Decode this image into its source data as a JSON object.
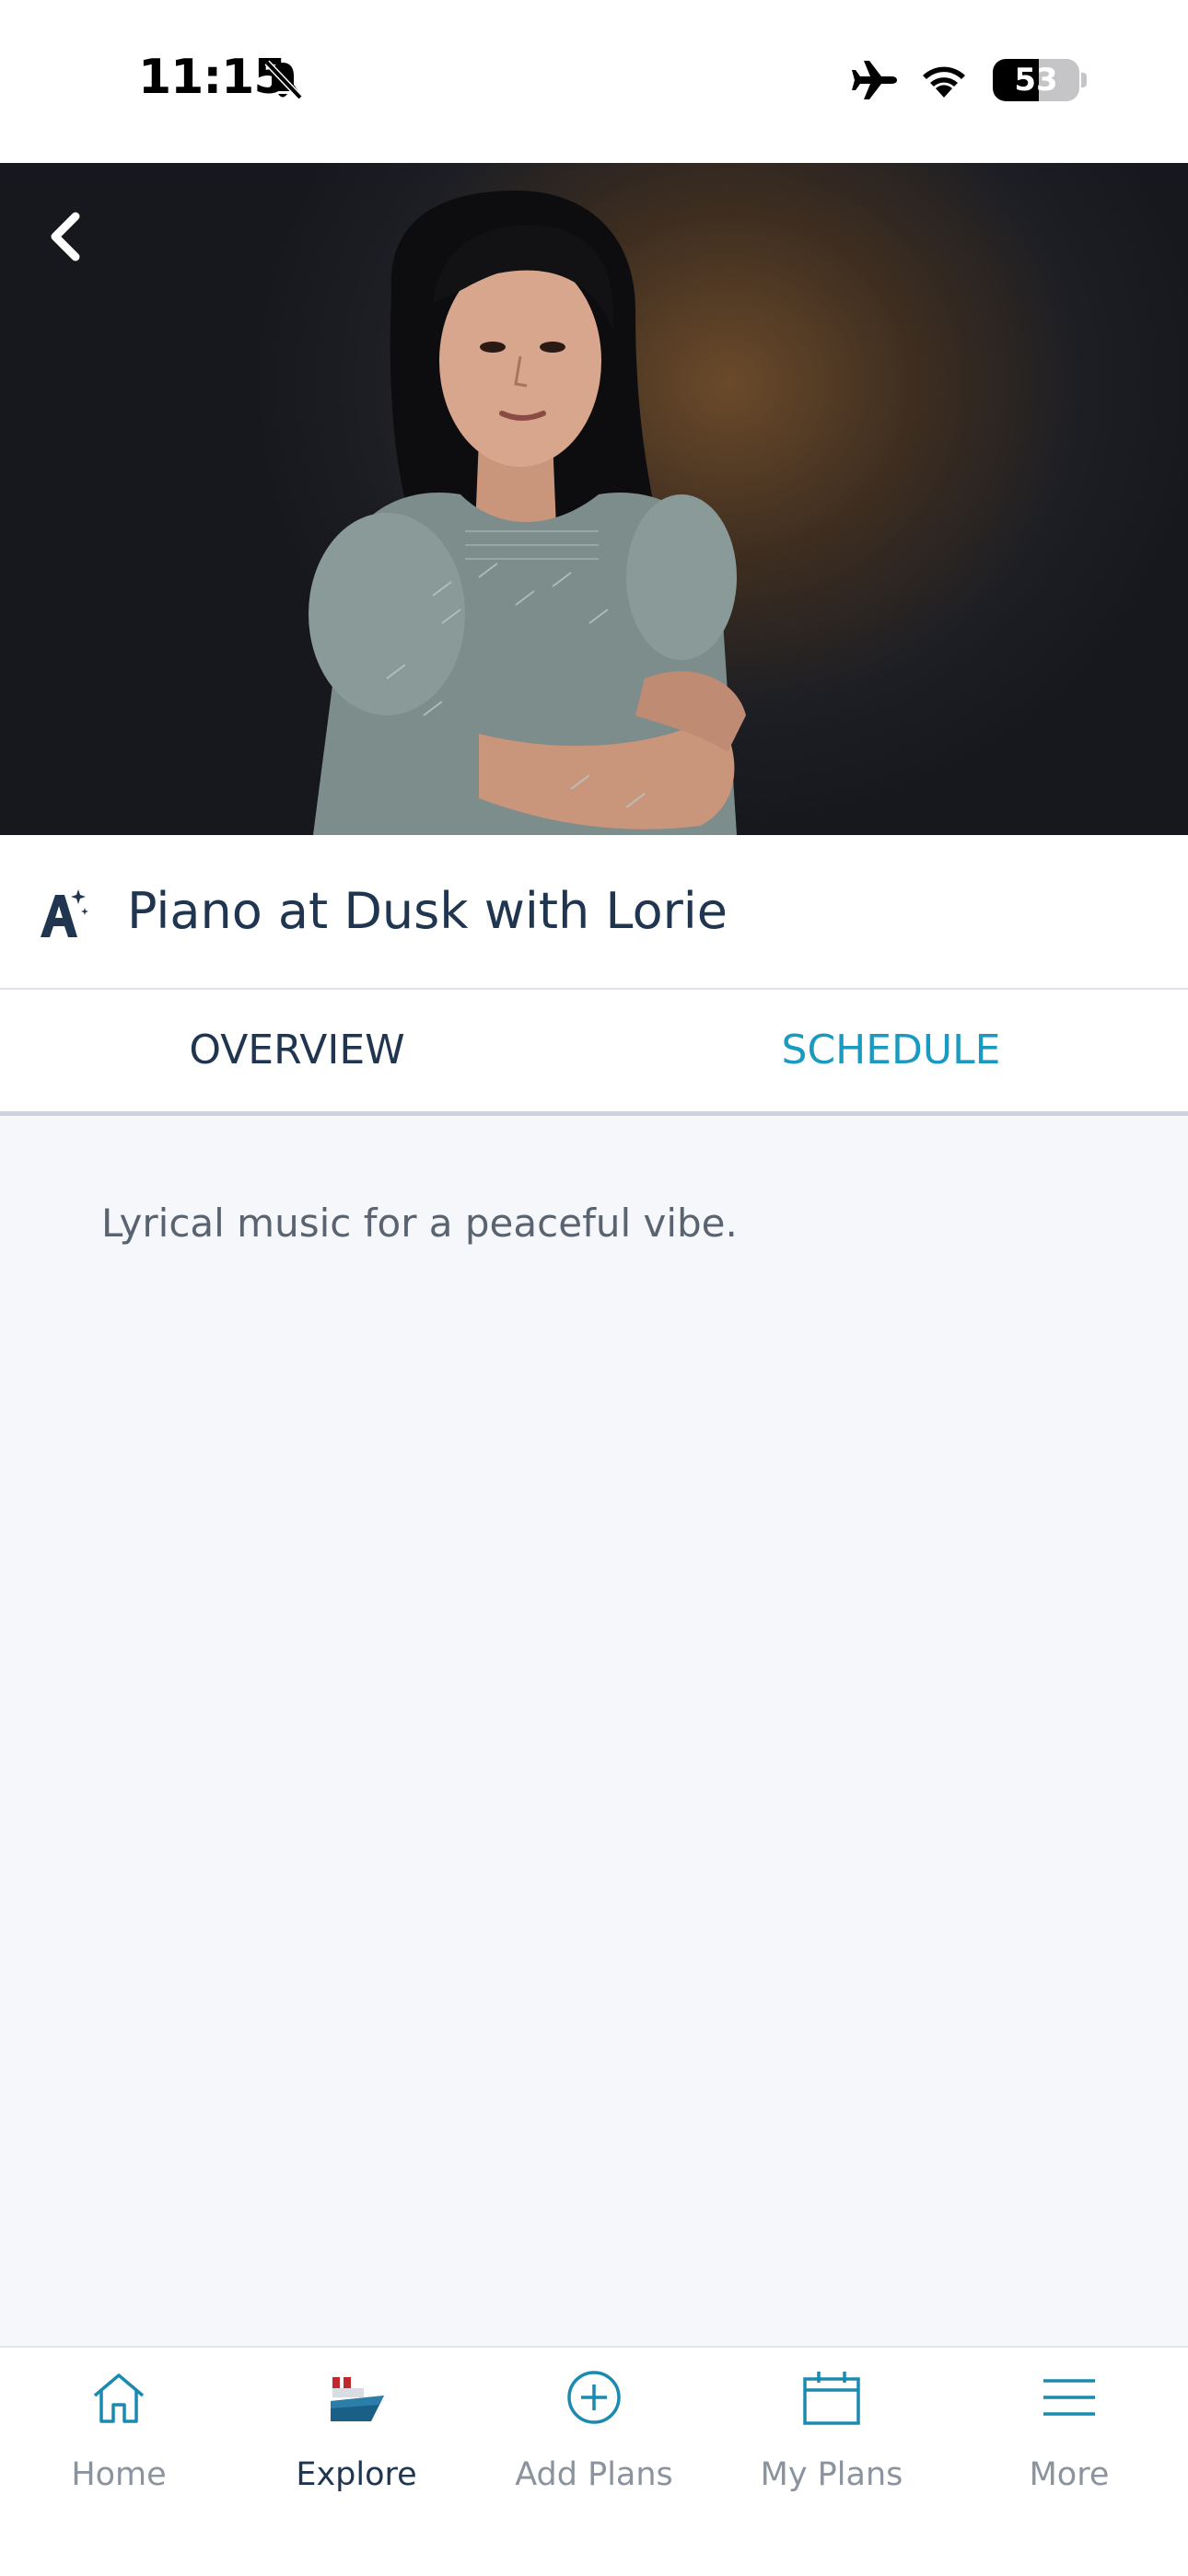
{
  "status_bar": {
    "time": "11:15",
    "battery_level": "53",
    "battery_fraction": 0.53,
    "icons": [
      "bell-slash-icon",
      "airplane-icon",
      "wifi-icon",
      "battery-icon"
    ]
  },
  "hero": {
    "image": "portrait-photo",
    "back_icon": "chevron-left-icon"
  },
  "event": {
    "title": "Piano at Dusk with Lorie",
    "category_icon": "entertainment-star-icon"
  },
  "tabs": [
    {
      "label": "OVERVIEW"
    },
    {
      "label": "SCHEDULE"
    }
  ],
  "overview": {
    "description": "Lyrical music for a peaceful vibe."
  },
  "colors": {
    "primary_text": "#1f3550",
    "accent": "#1a9ac0",
    "muted": "#8a939e",
    "background": "#f5f7fb"
  },
  "bottom_nav": {
    "items": [
      {
        "label": "Home",
        "icon": "house-icon"
      },
      {
        "label": "Explore",
        "icon": "ship-icon"
      },
      {
        "label": "Add Plans",
        "icon": "plus-circle-icon"
      },
      {
        "label": "My Plans",
        "icon": "calendar-icon"
      },
      {
        "label": "More",
        "icon": "menu-icon"
      }
    ]
  }
}
